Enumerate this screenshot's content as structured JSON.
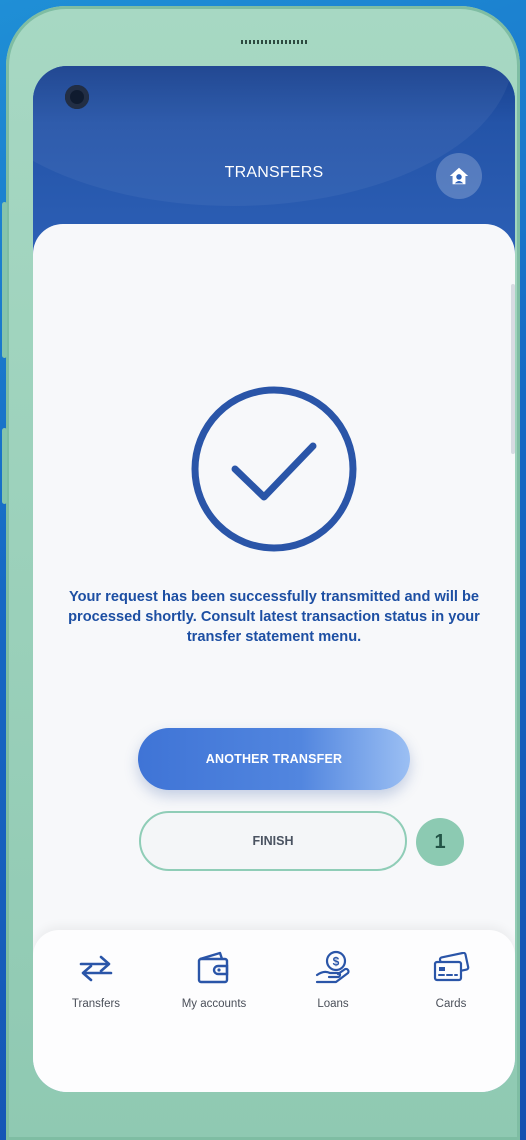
{
  "header": {
    "title": "TRANSFERS",
    "home_icon": "home-icon"
  },
  "result": {
    "status_icon": "check-circle-icon",
    "message_lines": [
      "Your request has been successfully transmitted and will be",
      "processed shortly. Consult latest transaction status in your",
      "transfer statement menu."
    ]
  },
  "actions": {
    "another_transfer_label": "ANOTHER TRANSFER",
    "finish_label": "FINISH",
    "step_badge": "1"
  },
  "bottom_nav": {
    "items": [
      {
        "label": "Transfers",
        "icon": "transfer-arrows-icon"
      },
      {
        "label": "My accounts",
        "icon": "wallet-icon"
      },
      {
        "label": "Loans",
        "icon": "loan-coin-icon"
      },
      {
        "label": "Cards",
        "icon": "cards-icon"
      }
    ]
  },
  "colors": {
    "primary": "#2f63ba",
    "accent_text": "#1d4fa3",
    "mint_frame": "#8fc9b2"
  }
}
